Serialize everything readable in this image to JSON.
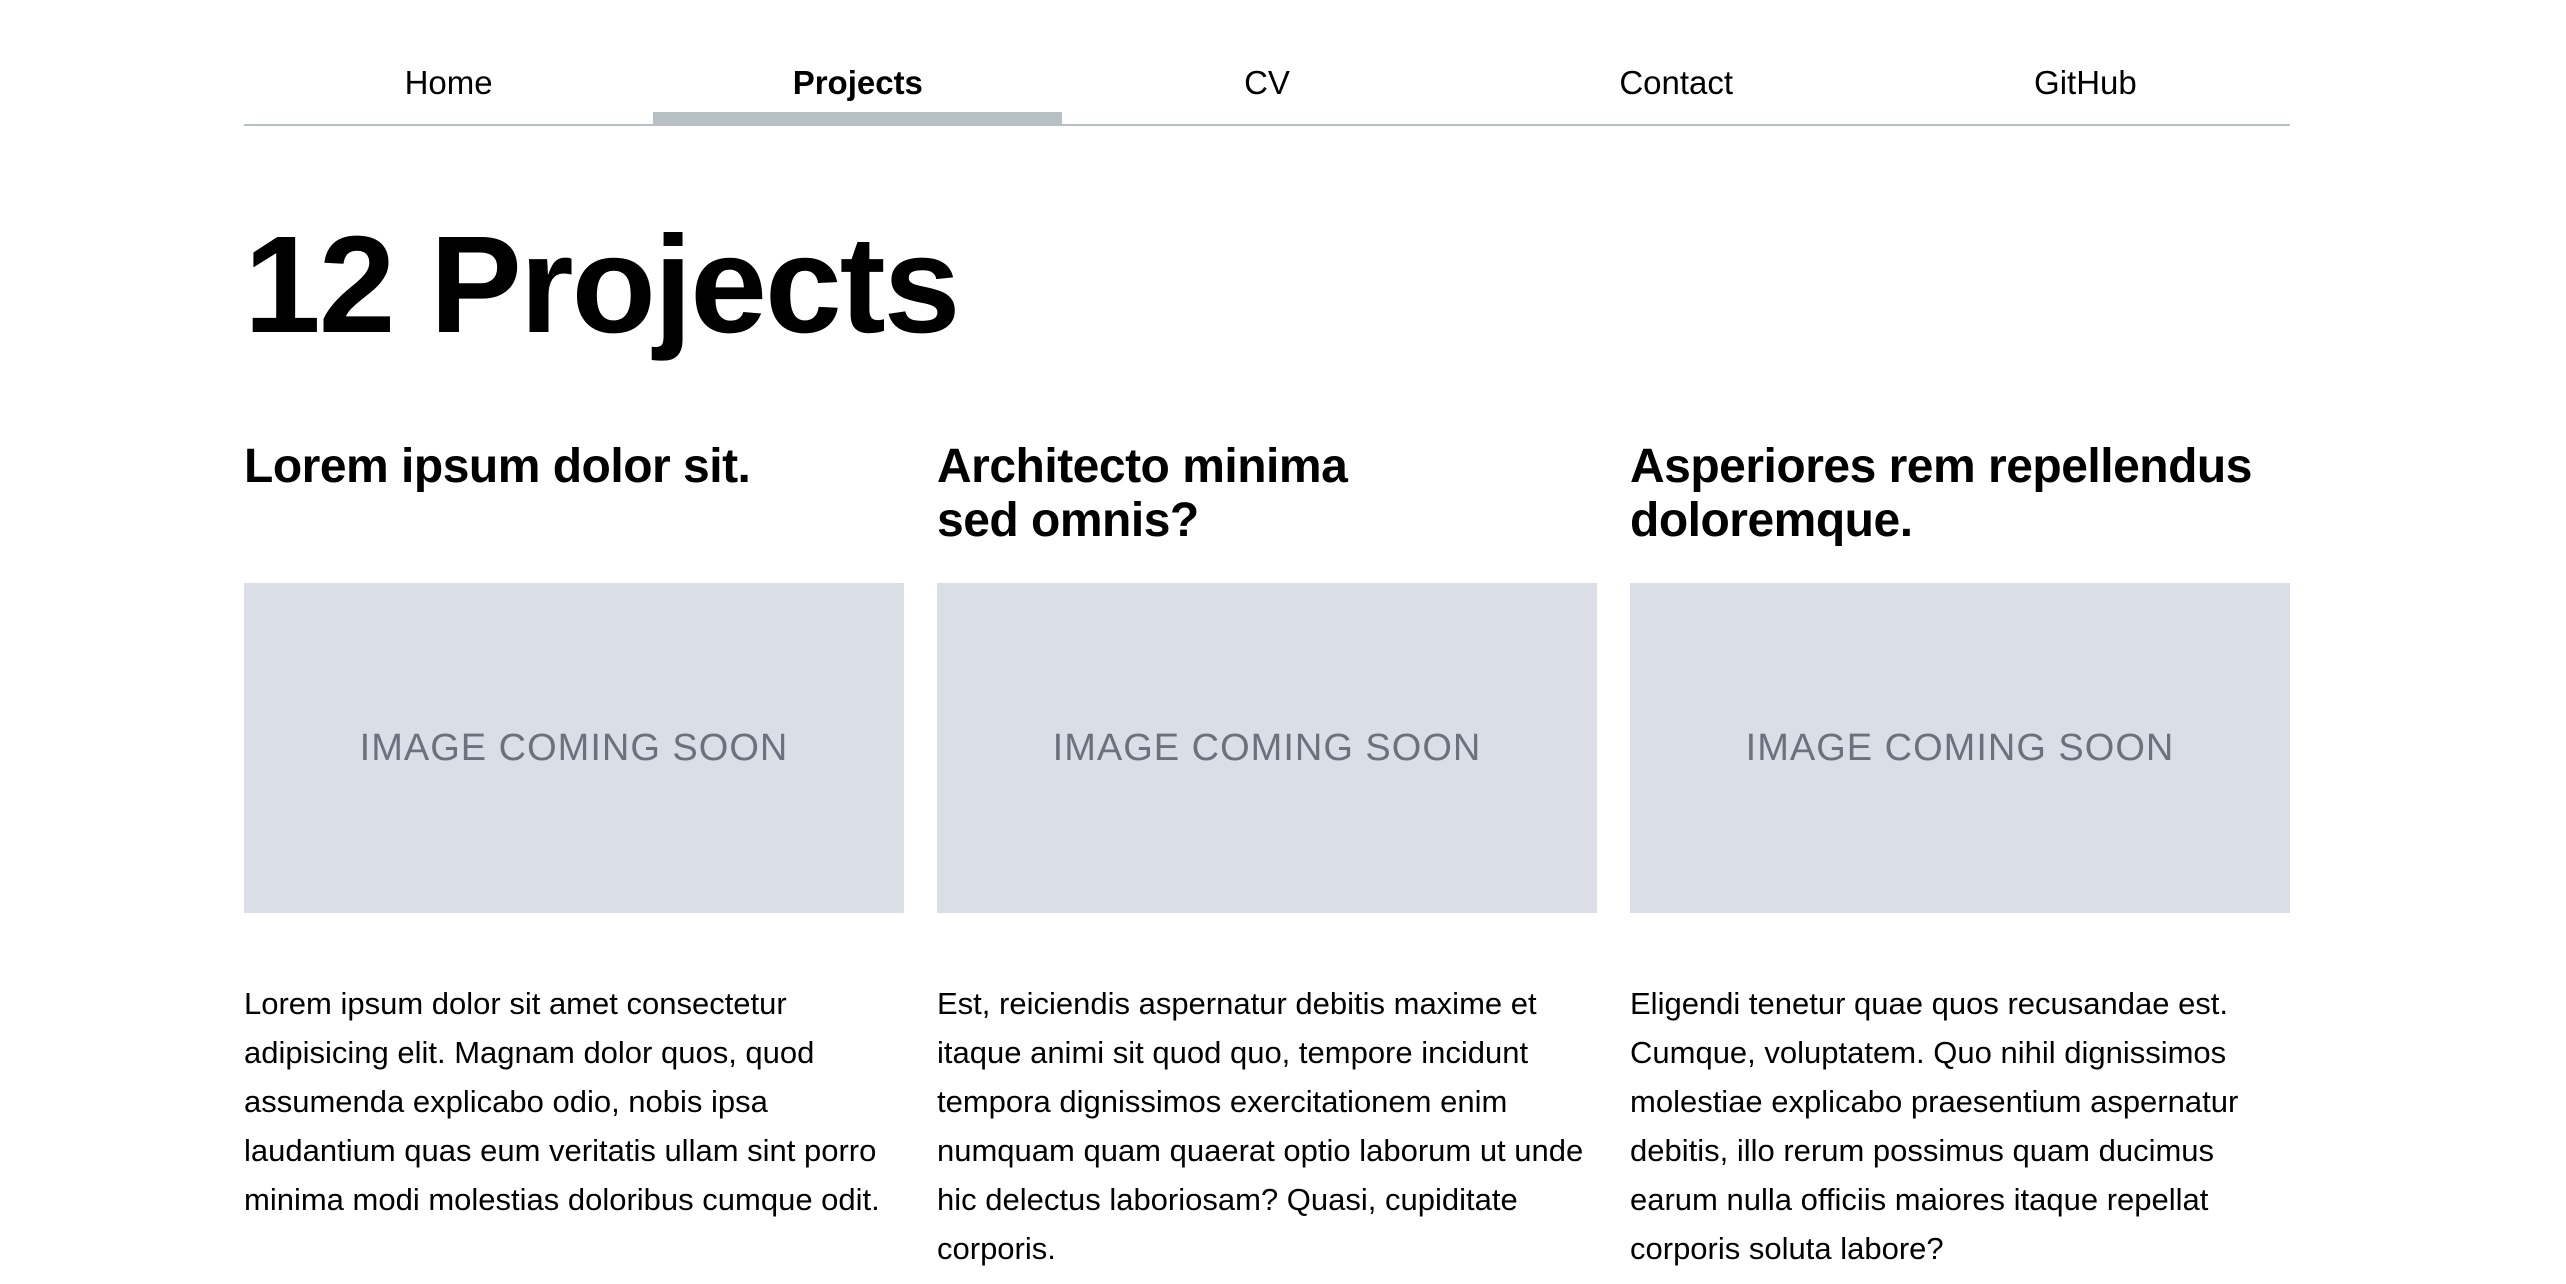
{
  "nav": {
    "items": [
      {
        "label": "Home",
        "active": false
      },
      {
        "label": "Projects",
        "active": true
      },
      {
        "label": "CV",
        "active": false
      },
      {
        "label": "Contact",
        "active": false
      },
      {
        "label": "GitHub",
        "active": false
      }
    ]
  },
  "page": {
    "title": "12 Projects"
  },
  "projects": [
    {
      "title": "Lorem ipsum dolor sit.",
      "image_placeholder": "IMAGE COMING SOON",
      "description": "Lorem ipsum dolor sit amet consectetur adipisicing elit. Magnam dolor quos, quod assumenda explicabo odio, nobis ipsa laudantium quas eum veritatis ullam sint porro minima modi molestias doloribus cumque odit."
    },
    {
      "title": "Architecto minima sed omnis?",
      "image_placeholder": "IMAGE COMING SOON",
      "description": "Est, reiciendis aspernatur debitis maxime et itaque animi sit quod quo, tempore incidunt tempora dignissimos exercitationem enim numquam quam quaerat optio laborum ut unde hic delectus laboriosam? Quasi, cupiditate corporis."
    },
    {
      "title": "Asperiores rem repellendus doloremque.",
      "image_placeholder": "IMAGE COMING SOON",
      "description": "Eligendi tenetur quae quos recusandae est. Cumque, voluptatem. Quo nihil dignissimos molestiae explicabo praesentium aspernatur debitis, illo rerum possimus quam ducimus earum nulla officiis maiores itaque repellat corporis soluta labore?"
    }
  ],
  "colors": {
    "nav_underline": "#b7c0c4",
    "image_placeholder_bg": "#dadee6",
    "image_placeholder_text": "#6c727d"
  }
}
